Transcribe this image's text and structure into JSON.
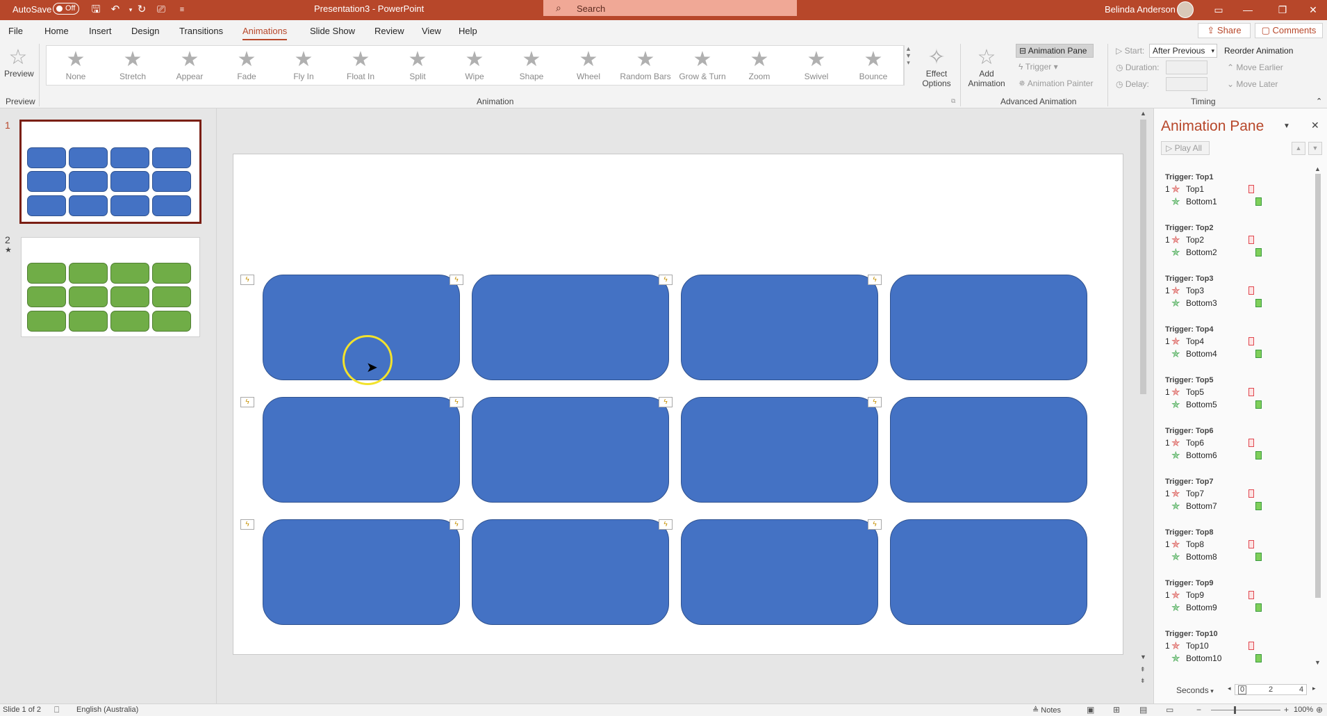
{
  "titlebar": {
    "autosave_label": "AutoSave",
    "autosave_state": "Off",
    "doc_title": "Presentation3 - PowerPoint",
    "search_placeholder": "Search",
    "user_name": "Belinda Anderson"
  },
  "tabs": [
    "File",
    "Home",
    "Insert",
    "Design",
    "Transitions",
    "Animations",
    "Slide Show",
    "Review",
    "View",
    "Help"
  ],
  "active_tab": "Animations",
  "share_label": "Share",
  "comments_label": "Comments",
  "ribbon": {
    "preview_label": "Preview",
    "preview_group": "Preview",
    "animation_group": "Animation",
    "gallery": [
      "None",
      "Stretch",
      "Appear",
      "Fade",
      "Fly In",
      "Float In",
      "Split",
      "Wipe",
      "Shape",
      "Wheel",
      "Random Bars",
      "Grow & Turn",
      "Zoom",
      "Swivel",
      "Bounce"
    ],
    "effect_options_line1": "Effect",
    "effect_options_line2": "Options",
    "add_animation_line1": "Add",
    "add_animation_line2": "Animation",
    "animation_pane_btn": "Animation Pane",
    "trigger_btn": "Trigger",
    "animation_painter_btn": "Animation Painter",
    "advanced_group": "Advanced Animation",
    "start_label": "Start:",
    "start_value": "After Previous",
    "duration_label": "Duration:",
    "delay_label": "Delay:",
    "reorder_label": "Reorder Animation",
    "move_earlier": "Move Earlier",
    "move_later": "Move Later",
    "timing_group": "Timing"
  },
  "thumbnails": [
    {
      "number": "1",
      "marker": ""
    },
    {
      "number": "2",
      "marker": "★"
    }
  ],
  "animation_pane": {
    "title": "Animation Pane",
    "play_all": "Play All",
    "triggers": [
      {
        "label": "Trigger: Top1",
        "first": "Top1",
        "second": "Bottom1"
      },
      {
        "label": "Trigger: Top2",
        "first": "Top2",
        "second": "Bottom2"
      },
      {
        "label": "Trigger: Top3",
        "first": "Top3",
        "second": "Bottom3"
      },
      {
        "label": "Trigger: Top4",
        "first": "Top4",
        "second": "Bottom4"
      },
      {
        "label": "Trigger: Top5",
        "first": "Top5",
        "second": "Bottom5"
      },
      {
        "label": "Trigger: Top6",
        "first": "Top6",
        "second": "Bottom6"
      },
      {
        "label": "Trigger: Top7",
        "first": "Top7",
        "second": "Bottom7"
      },
      {
        "label": "Trigger: Top8",
        "first": "Top8",
        "second": "Bottom8"
      },
      {
        "label": "Trigger: Top9",
        "first": "Top9",
        "second": "Bottom9"
      },
      {
        "label": "Trigger: Top10",
        "first": "Top10",
        "second": "Bottom10"
      }
    ],
    "order_number": "1",
    "seconds_label": "Seconds",
    "timeline_ticks": [
      "0",
      "2",
      "4"
    ]
  },
  "status": {
    "slide_info": "Slide 1 of 2",
    "language": "English (Australia)",
    "notes_label": "Notes",
    "zoom": "100%"
  },
  "colors": {
    "accent": "#b7472a",
    "box_fill": "#4472c4",
    "box_border": "#2f528f",
    "green_fill": "#70ad47"
  }
}
